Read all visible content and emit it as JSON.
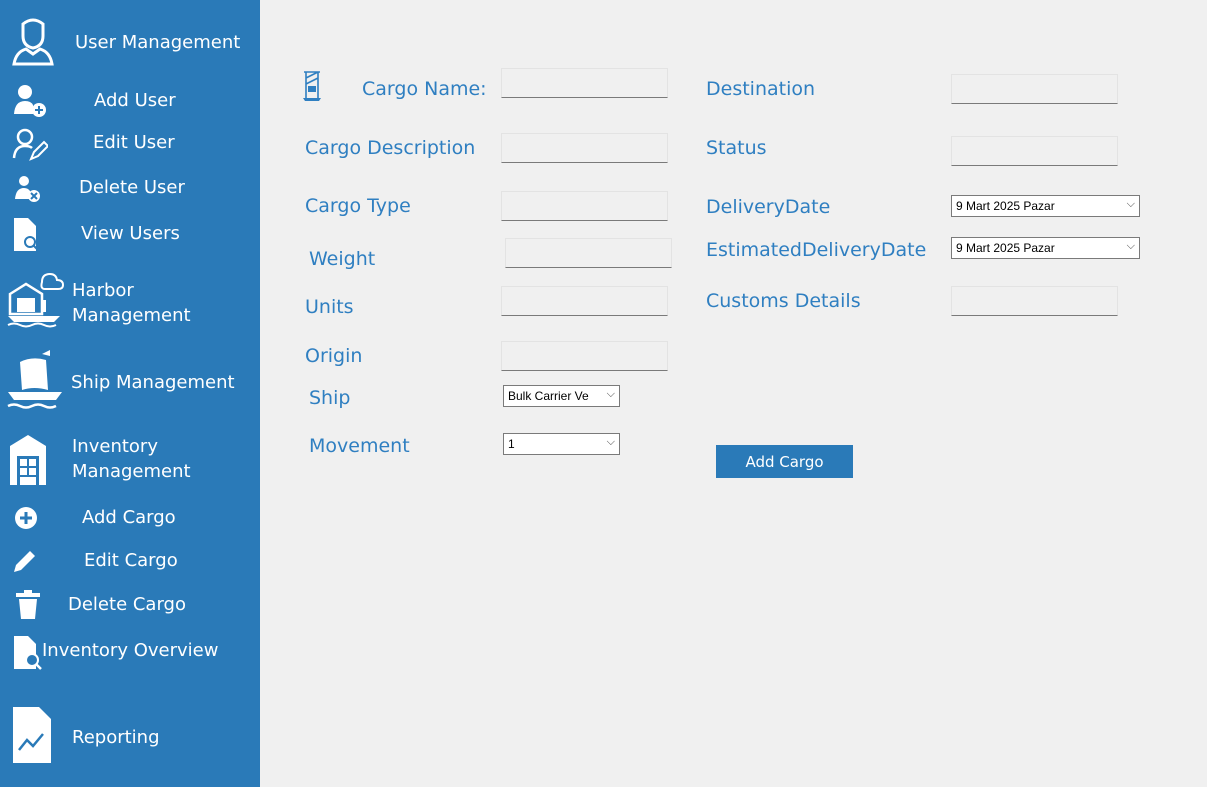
{
  "sidebar": {
    "user_management": "User Management",
    "add_user": "Add User",
    "edit_user": "Edit User",
    "delete_user": "Delete User",
    "view_users": "View Users",
    "harbor_management_1": "Harbor",
    "harbor_management_2": "Management",
    "ship_management": "Ship Management",
    "inventory_management_1": "Inventory",
    "inventory_management_2": "Management",
    "add_cargo": "Add Cargo",
    "edit_cargo": "Edit Cargo",
    "delete_cargo": "Delete Cargo",
    "inventory_overview": "Inventory Overview",
    "reporting": "Reporting"
  },
  "form": {
    "cargo_name_label": "Cargo Name:",
    "cargo_description_label": "Cargo Description",
    "cargo_type_label": "Cargo Type",
    "weight_label": "Weight",
    "units_label": "Units",
    "origin_label": "Origin",
    "ship_label": "Ship",
    "movement_label": "Movement",
    "destination_label": "Destination",
    "status_label": "Status",
    "delivery_date_label": "DeliveryDate",
    "estimated_delivery_date_label": "EstimatedDeliveryDate",
    "customs_details_label": "Customs Details",
    "ship_value": "Bulk Carrier Ve",
    "movement_value": "1",
    "delivery_date_value": "9   Mart   2025   Pazar",
    "estimated_delivery_date_value": "9   Mart   2025   Pazar",
    "add_cargo_button": "Add Cargo"
  },
  "colors": {
    "sidebar": "#2a7ab8",
    "label": "#2f7fc1",
    "background": "#f0f0f0"
  }
}
